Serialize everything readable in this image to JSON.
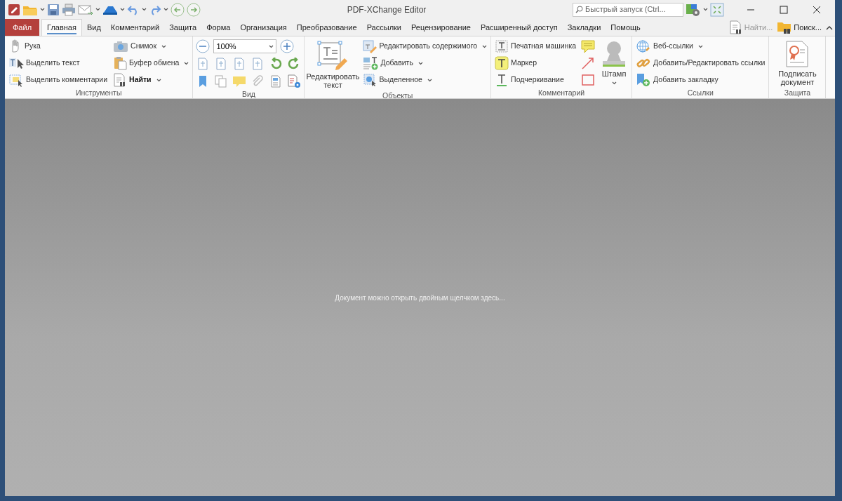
{
  "window": {
    "title": "PDF-XChange Editor"
  },
  "quick_launch": {
    "placeholder": "Быстрый запуск (Ctrl..."
  },
  "menu_tabs": [
    {
      "label": "Файл",
      "kind": "file",
      "selected": false
    },
    {
      "label": "Главная",
      "kind": "tab",
      "selected": true
    },
    {
      "label": "Вид",
      "kind": "tab",
      "selected": false
    },
    {
      "label": "Комментарий",
      "kind": "tab",
      "selected": false
    },
    {
      "label": "Защита",
      "kind": "tab",
      "selected": false
    },
    {
      "label": "Форма",
      "kind": "tab",
      "selected": false
    },
    {
      "label": "Организация",
      "kind": "tab",
      "selected": false
    },
    {
      "label": "Преобразование",
      "kind": "tab",
      "selected": false
    },
    {
      "label": "Рассылки",
      "kind": "tab",
      "selected": false
    },
    {
      "label": "Рецензирование",
      "kind": "tab",
      "selected": false
    },
    {
      "label": "Расширенный доступ",
      "kind": "tab",
      "selected": false
    },
    {
      "label": "Закладки",
      "kind": "tab",
      "selected": false
    },
    {
      "label": "Помощь",
      "kind": "tab",
      "selected": false
    }
  ],
  "tab_tools": [
    {
      "label": "Найти...",
      "disabled": true
    },
    {
      "label": "Поиск...",
      "disabled": false
    }
  ],
  "ribbon": [
    {
      "label": "Инструменты",
      "columns": [
        {
          "kind": "small_list",
          "items": [
            {
              "label": "Рука",
              "dropdown": false,
              "bold": false
            },
            {
              "label": "Выделить текст",
              "dropdown": false,
              "bold": false
            },
            {
              "label": "Выделить комментарии",
              "dropdown": false,
              "bold": false
            }
          ]
        },
        {
          "kind": "small_list",
          "items": [
            {
              "label": "Снимок",
              "dropdown": true,
              "bold": false
            },
            {
              "label": "Буфер обмена",
              "dropdown": true,
              "bold": false
            },
            {
              "label": "Найти",
              "dropdown": true,
              "bold": true
            }
          ]
        }
      ]
    },
    {
      "label": "Вид",
      "columns": [
        {
          "kind": "view_tools",
          "zoom_value": "100%"
        }
      ]
    },
    {
      "label": "Объекты",
      "columns": [
        {
          "kind": "large",
          "label": "Редактировать текст",
          "dropdown": false
        },
        {
          "kind": "small_list",
          "items": [
            {
              "label": "Редактировать содержимого",
              "dropdown": true,
              "bold": false
            },
            {
              "label": "Добавить",
              "dropdown": true,
              "bold": false
            },
            {
              "label": "Выделенное",
              "dropdown": true,
              "bold": false
            }
          ]
        }
      ]
    },
    {
      "label": "Комментарий",
      "columns": [
        {
          "kind": "small_list",
          "items": [
            {
              "label": "Печатная машинка",
              "dropdown": false,
              "bold": false
            },
            {
              "label": "Маркер",
              "dropdown": false,
              "bold": false
            },
            {
              "label": "Подчеркивание",
              "dropdown": false,
              "bold": false
            }
          ]
        },
        {
          "kind": "icon_column"
        },
        {
          "kind": "large",
          "label": "Штамп",
          "dropdown": true
        }
      ]
    },
    {
      "label": "Ссылки",
      "columns": [
        {
          "kind": "small_list",
          "items": [
            {
              "label": "Веб-ссылки",
              "dropdown": true,
              "bold": false
            },
            {
              "label": "Добавить/Редактировать ссылки",
              "dropdown": false,
              "bold": false
            },
            {
              "label": "Добавить закладку",
              "dropdown": false,
              "bold": false
            }
          ]
        }
      ]
    },
    {
      "label": "Защита",
      "columns": [
        {
          "kind": "large",
          "label": "Подписать документ",
          "dropdown": false
        }
      ]
    }
  ],
  "document_area": {
    "hint": "Документ можно открыть двойным щелчком здесь..."
  }
}
